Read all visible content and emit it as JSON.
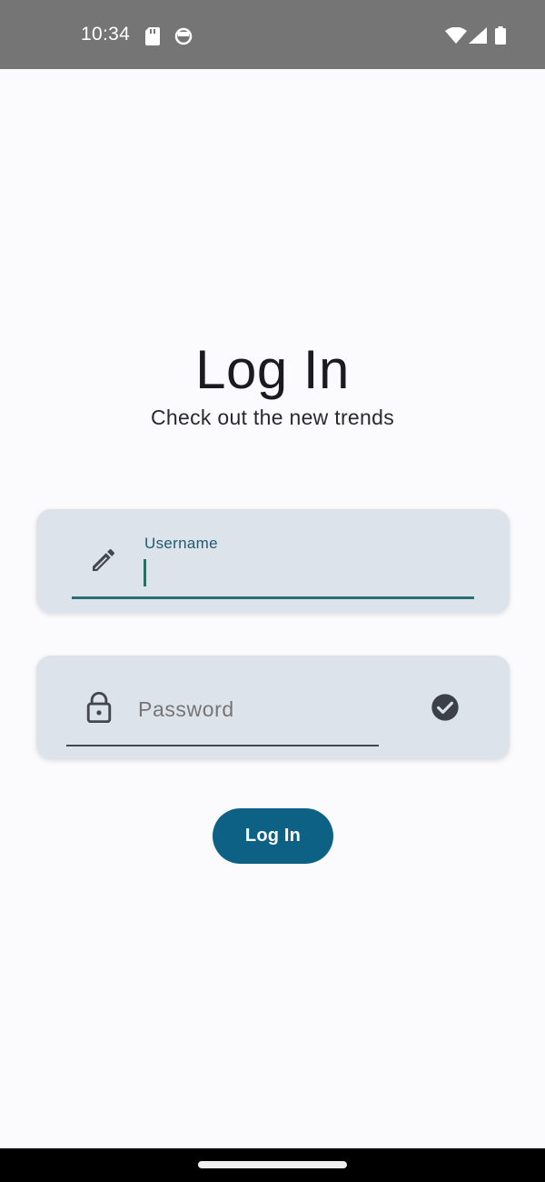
{
  "status_bar": {
    "time": "10:34",
    "icons": [
      "sd-card-icon",
      "circle-status-icon",
      "wifi-icon",
      "signal-icon",
      "battery-icon"
    ]
  },
  "header": {
    "title": "Log In",
    "subtitle": "Check out the new trends"
  },
  "form": {
    "username": {
      "label": "Username",
      "value": "",
      "icon": "pencil-icon",
      "focused": true
    },
    "password": {
      "placeholder": "Password",
      "value": "",
      "icon": "lock-icon",
      "trailing_icon": "check-circle-icon"
    },
    "submit_label": "Log In"
  },
  "colors": {
    "accent": "#0d6185",
    "field_background": "#dde3ea",
    "focus_underline": "#2a6f73",
    "label": "#1e5b73",
    "status_bar": "#757575"
  }
}
